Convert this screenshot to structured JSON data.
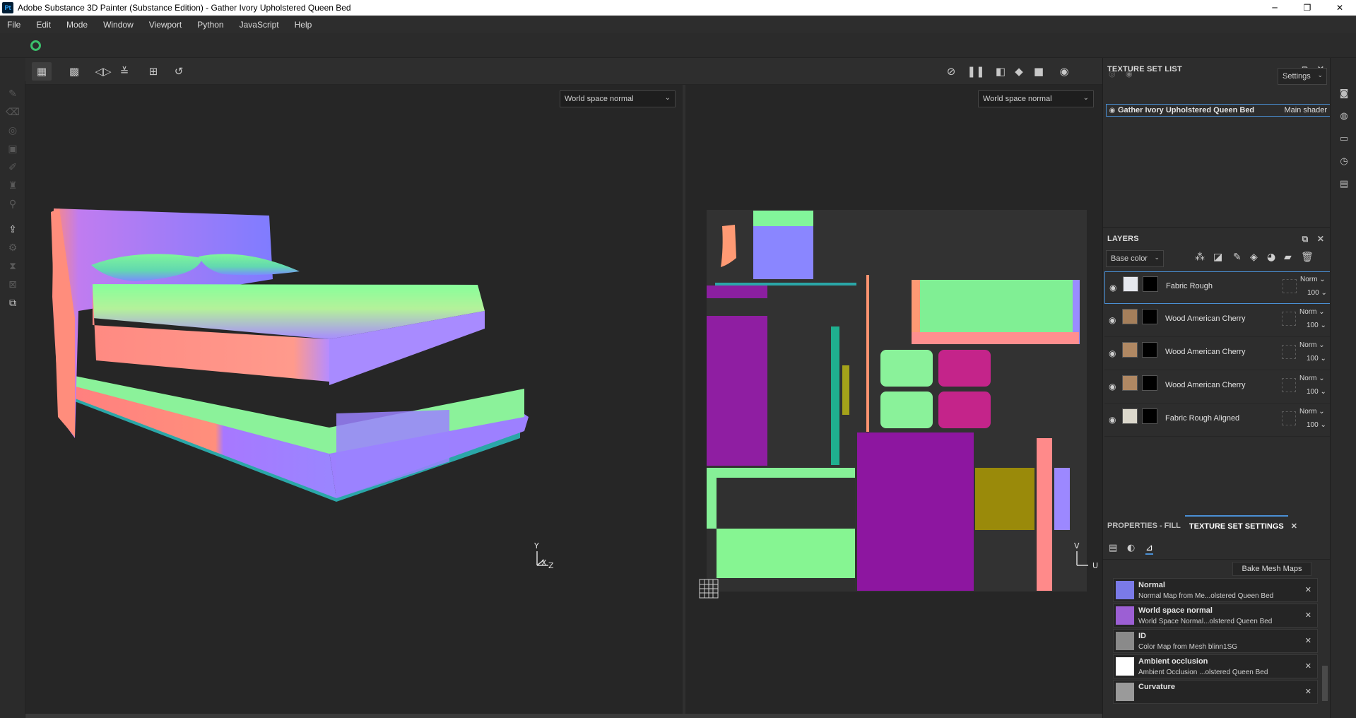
{
  "window": {
    "app_icon": "Pt",
    "title": "Adobe Substance 3D Painter (Substance Edition) - Gather Ivory Upholstered Queen Bed",
    "controls": {
      "minimize": "─",
      "maximize": "❐",
      "close": "✕"
    }
  },
  "menu": [
    "File",
    "Edit",
    "Mode",
    "Window",
    "Viewport",
    "Python",
    "JavaScript",
    "Help"
  ],
  "viewport": {
    "left_mode": "World space normal",
    "right_mode": "World space normal",
    "axis_3d": {
      "y": "Y",
      "x": "X",
      "z": "Z"
    },
    "axis_2d": {
      "v": "V",
      "u": "U"
    }
  },
  "texture_set_list": {
    "title": "TEXTURE SET LIST",
    "settings_label": "Settings",
    "item_name": "Gather Ivory Upholstered Queen Bed",
    "item_shader": "Main shader"
  },
  "layers": {
    "title": "LAYERS",
    "channel": "Base color",
    "items": [
      {
        "name": "Fabric Rough",
        "blend": "Norm",
        "opacity": "100",
        "thumb_color": "#e6e8ee",
        "selected": true
      },
      {
        "name": "Wood American Cherry",
        "blend": "Norm",
        "opacity": "100",
        "thumb_color": "#a57f5b",
        "selected": false
      },
      {
        "name": "Wood American Cherry",
        "blend": "Norm",
        "opacity": "100",
        "thumb_color": "#b08863",
        "selected": false
      },
      {
        "name": "Wood American Cherry",
        "blend": "Norm",
        "opacity": "100",
        "thumb_color": "#b08863",
        "selected": false
      },
      {
        "name": "Fabric Rough Aligned",
        "blend": "Norm",
        "opacity": "100",
        "thumb_color": "#dcd8cc",
        "selected": false
      }
    ]
  },
  "properties": {
    "tab_fill": "PROPERTIES - FILL",
    "tab_texset": "TEXTURE SET SETTINGS",
    "bake_button": "Bake Mesh Maps",
    "maps": [
      {
        "title": "Normal",
        "sub": "Normal Map from Me...olstered Queen Bed",
        "color": "#7a7ae8"
      },
      {
        "title": "World space normal",
        "sub": "World Space Normal...olstered Queen Bed",
        "color": "#9c5fd4"
      },
      {
        "title": "ID",
        "sub": "Color Map from Mesh blinn1SG",
        "color": "#8a8a8a"
      },
      {
        "title": "Ambient occlusion",
        "sub": "Ambient Occlusion ...olstered Queen Bed",
        "color": "#ffffff"
      },
      {
        "title": "Curvature",
        "sub": "",
        "color": "#9a9a9a"
      }
    ]
  },
  "colors": {
    "accent": "#4a8fd4",
    "sync": "#3bbf6b"
  }
}
